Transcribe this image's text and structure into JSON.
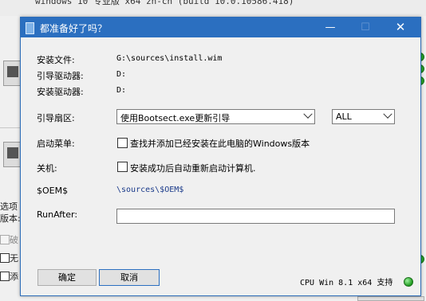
{
  "background": {
    "top_strip_text": "windows 10 专业版 x64 zh-cn (build 10.0.10586.418)",
    "side_labels": [
      "选项",
      "版本:"
    ],
    "checkbox_labels": [
      "破",
      "无",
      "添"
    ]
  },
  "dialog": {
    "title": "都准备好了吗？",
    "controls": {
      "minimize": "—",
      "maximize": "☐",
      "close": "✕"
    },
    "fields": {
      "install_file_label": "安装文件:",
      "install_file_value": "G:\\sources\\install.wim",
      "boot_drive_label": "引导驱动器:",
      "boot_drive_value": "D:",
      "install_drive_label": "安装驱动器:",
      "install_drive_value": "D:",
      "boot_sector_label": "引导扇区:",
      "boot_sector_select": "使用Bootsect.exe更新引导",
      "boot_sector_target": "ALL",
      "boot_menu_label": "启动菜单:",
      "boot_menu_option": "查找并添加已经安装在此电脑的Windows版本",
      "shutdown_label": "关机:",
      "shutdown_option": "安装成功后自动重新启动计算机.",
      "oem_label": "$OEM$",
      "oem_value": "\\sources\\$OEM$",
      "runafter_label": "RunAfter:",
      "runafter_value": ""
    },
    "buttons": {
      "ok": "确定",
      "cancel": "取消"
    },
    "status_text": "CPU Win 8.1 x64 支持"
  },
  "colors": {
    "titlebar": "#2b6fc0",
    "status_led": "#1e9a1e",
    "path_text": "#1a3a8a"
  }
}
